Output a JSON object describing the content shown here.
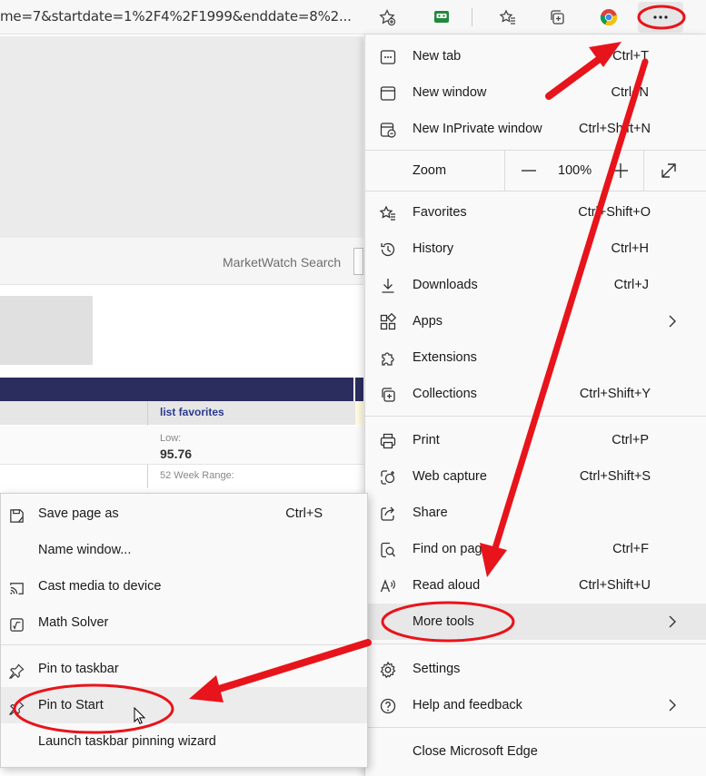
{
  "browser": {
    "url": "me=7&startdate=1%2F4%2F1999&enddate=8%2...",
    "icons": [
      "add-favorite-star-icon",
      "extension-icon",
      "favorites-icon",
      "collections-icon",
      "chrome-icon",
      "more-icon"
    ]
  },
  "page": {
    "search_label": "MarketWatch Search",
    "list_favorites": "list favorites",
    "low_label": "Low:",
    "low_value": "95.76",
    "range_label": "52 Week Range:"
  },
  "menu": {
    "new_tab": {
      "label": "New tab",
      "shortcut": "Ctrl+T"
    },
    "new_window": {
      "label": "New window",
      "shortcut": "Ctrl+N"
    },
    "new_inprivate": {
      "label": "New InPrivate window",
      "shortcut": "Ctrl+Shift+N"
    },
    "zoom": {
      "label": "Zoom",
      "minus": "—",
      "value": "100%",
      "plus": "+"
    },
    "favorites": {
      "label": "Favorites",
      "shortcut": "Ctrl+Shift+O"
    },
    "history": {
      "label": "History",
      "shortcut": "Ctrl+H"
    },
    "downloads": {
      "label": "Downloads",
      "shortcut": "Ctrl+J"
    },
    "apps": {
      "label": "Apps"
    },
    "extensions": {
      "label": "Extensions"
    },
    "collections": {
      "label": "Collections",
      "shortcut": "Ctrl+Shift+Y"
    },
    "print": {
      "label": "Print",
      "shortcut": "Ctrl+P"
    },
    "web_capture": {
      "label": "Web capture",
      "shortcut": "Ctrl+Shift+S"
    },
    "share": {
      "label": "Share"
    },
    "find_on_page": {
      "label": "Find on page",
      "shortcut": "Ctrl+F"
    },
    "read_aloud": {
      "label": "Read aloud",
      "shortcut": "Ctrl+Shift+U"
    },
    "more_tools": {
      "label": "More tools"
    },
    "settings": {
      "label": "Settings"
    },
    "help": {
      "label": "Help and feedback"
    },
    "close": {
      "label": "Close Microsoft Edge"
    }
  },
  "submenu": {
    "save_page": {
      "label": "Save page as",
      "shortcut": "Ctrl+S"
    },
    "name_window": {
      "label": "Name window..."
    },
    "cast": {
      "label": "Cast media to device"
    },
    "math_solver": {
      "label": "Math Solver"
    },
    "pin_taskbar": {
      "label": "Pin to taskbar"
    },
    "pin_start": {
      "label": "Pin to Start"
    },
    "launch_wizard": {
      "label": "Launch taskbar pinning wizard"
    }
  },
  "colors": {
    "annotation_red": "#e8141b",
    "navy": "#2b2d5e",
    "menu_bg": "#f9f9f9",
    "highlight": "#e8e8e8"
  }
}
